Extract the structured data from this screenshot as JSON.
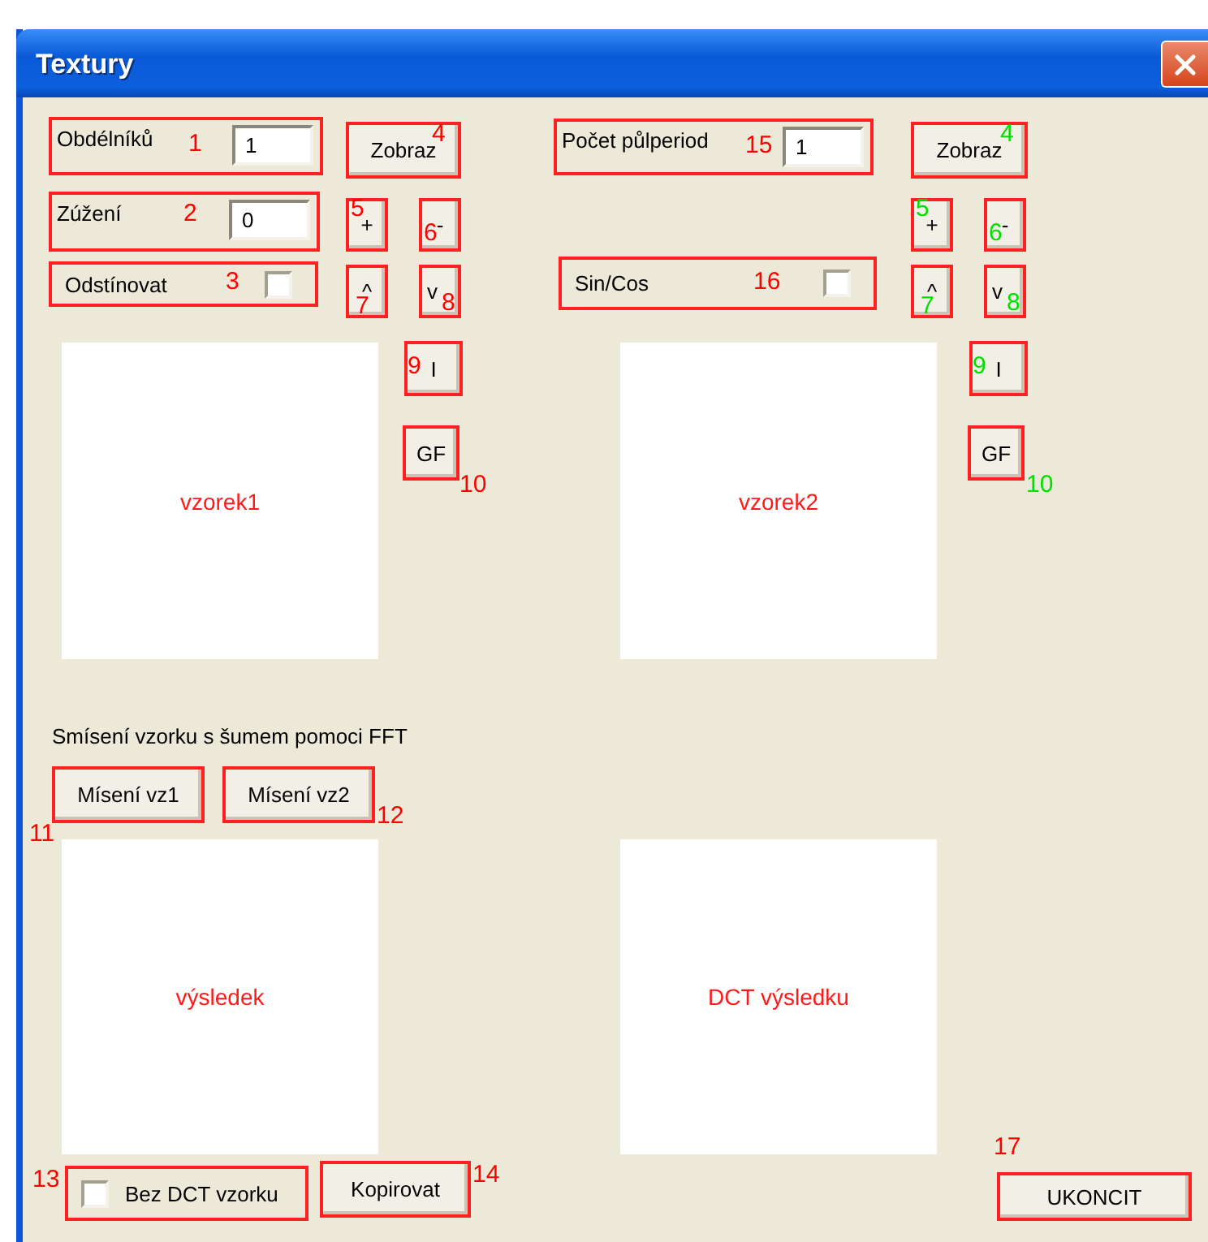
{
  "window": {
    "title": "Textury"
  },
  "controls": [
    {
      "kind": "field",
      "label": "Obdélníků",
      "value": "1",
      "mark": "1",
      "color": "#ff0000"
    },
    {
      "kind": "button",
      "label": "Zobraz",
      "mark": "4",
      "color": "#ff0000"
    },
    {
      "kind": "field",
      "label": "Počet půlperiod",
      "value": "1",
      "mark": "15",
      "color": "#ff0000"
    },
    {
      "kind": "button",
      "label": "Zobraz",
      "mark": "4",
      "color": "#00e000"
    },
    {
      "kind": "field",
      "label": "Zúžení",
      "value": "0",
      "mark": "2",
      "color": "#ff0000"
    },
    {
      "kind": "button",
      "label": "+",
      "mark": "5",
      "color": "#ff0000"
    },
    {
      "kind": "button",
      "label": "-",
      "mark": "6",
      "color": "#ff0000"
    },
    {
      "kind": "button",
      "label": "+",
      "mark": "5",
      "color": "#00e000"
    },
    {
      "kind": "button",
      "label": "-",
      "mark": "6",
      "color": "#00e000"
    },
    {
      "kind": "checkbox",
      "label": "Odstínovat",
      "checked": false,
      "mark": "3",
      "color": "#ff0000"
    },
    {
      "kind": "button",
      "label": "^",
      "mark": "7",
      "color": "#ff0000"
    },
    {
      "kind": "button",
      "label": "v",
      "mark": "8",
      "color": "#ff0000"
    },
    {
      "kind": "checkbox",
      "label": "Sin/Cos",
      "checked": false,
      "mark": "16",
      "color": "#ff0000"
    },
    {
      "kind": "button",
      "label": "^",
      "mark": "7",
      "color": "#00e000"
    },
    {
      "kind": "button",
      "label": "v",
      "mark": "8",
      "color": "#00e000"
    },
    {
      "kind": "panel",
      "label": "vzorek1"
    },
    {
      "kind": "button",
      "label": "I",
      "mark": "9",
      "color": "#ff0000"
    },
    {
      "kind": "button",
      "label": "GF",
      "mark": "10",
      "color": "#ff0000"
    },
    {
      "kind": "panel",
      "label": "vzorek2"
    },
    {
      "kind": "button",
      "label": "I",
      "mark": "9",
      "color": "#00e000"
    },
    {
      "kind": "button",
      "label": "GF",
      "mark": "10",
      "color": "#00e000"
    },
    {
      "kind": "text",
      "label": "Smísení vzorku s šumem pomoci FFT"
    },
    {
      "kind": "button",
      "label": "Mísení vz1",
      "mark": "11",
      "color": "#ff0000"
    },
    {
      "kind": "button",
      "label": "Mísení vz2",
      "mark": "12",
      "color": "#ff0000"
    },
    {
      "kind": "panel",
      "label": "výsledek"
    },
    {
      "kind": "panel",
      "label": "DCT výsledku"
    },
    {
      "kind": "checkbox",
      "label": "Bez DCT vzorku",
      "checked": false,
      "mark": "13",
      "color": "#ff0000"
    },
    {
      "kind": "button",
      "label": "Kopirovat",
      "mark": "14",
      "color": "#ff0000"
    },
    {
      "kind": "button",
      "label": "UKONCIT",
      "mark": "17",
      "color": "#ff0000"
    }
  ]
}
